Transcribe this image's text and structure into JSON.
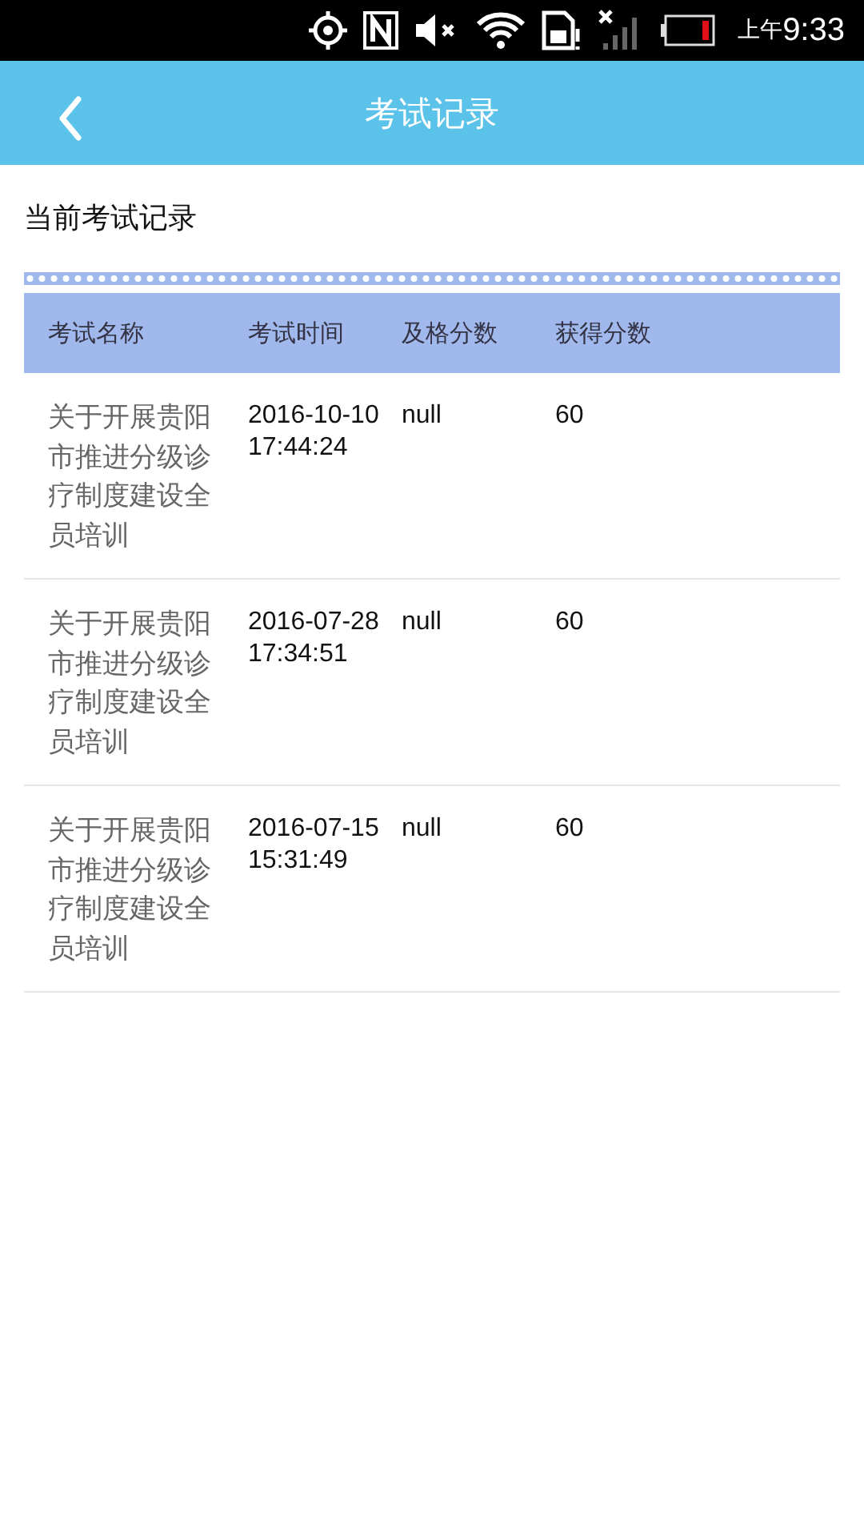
{
  "status_bar": {
    "am_pm": "上午",
    "time": "9:33"
  },
  "header": {
    "title": "考试记录"
  },
  "section_title": "当前考试记录",
  "table": {
    "columns": [
      "考试名称",
      "考试时间",
      "及格分数",
      "获得分数"
    ],
    "rows": [
      {
        "name": "关于开展贵阳市推进分级诊疗制度建设全员培训",
        "time": "2016-10-10 17:44:24",
        "pass_score": "null",
        "score": "60"
      },
      {
        "name": "关于开展贵阳市推进分级诊疗制度建设全员培训",
        "time": "2016-07-28 17:34:51",
        "pass_score": "null",
        "score": "60"
      },
      {
        "name": "关于开展贵阳市推进分级诊疗制度建设全员培训",
        "time": "2016-07-15 15:31:49",
        "pass_score": "null",
        "score": "60"
      }
    ]
  }
}
